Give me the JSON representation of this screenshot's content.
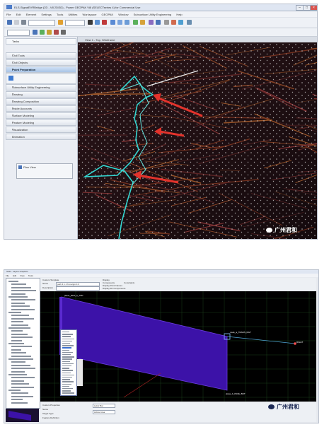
{
  "top_window": {
    "title": "ELS-SignalEVRBridge (2D - V8 2D/3D) - Power GEOPAK V8i (SELECTseries 4) for Commercial Use",
    "menu": [
      "File",
      "Edit",
      "Element",
      "Settings",
      "Tools",
      "Utilities",
      "Workspace",
      "GEOPAK",
      "Window",
      "Subsurface Utility Engineering",
      "Help"
    ],
    "sidebar": {
      "task_title": "Tasks",
      "sections": [
        {
          "label": "Civil Tools",
          "kind": "item"
        },
        {
          "label": "Civil Objects",
          "kind": "item"
        },
        {
          "label": "Point Preparation",
          "kind": "header"
        },
        {
          "label": "Subsurface Utility Engineering",
          "kind": "item"
        },
        {
          "label": "Drawing",
          "kind": "item"
        },
        {
          "label": "Drawing Composition",
          "kind": "item"
        },
        {
          "label": "Inside Accounts",
          "kind": "item"
        },
        {
          "label": "Surface Modeling",
          "kind": "item"
        },
        {
          "label": "Feature Modeling",
          "kind": "item"
        },
        {
          "label": "Visualization",
          "kind": "item"
        },
        {
          "label": "Animation",
          "kind": "item"
        }
      ],
      "flyout_label": "Plan View"
    },
    "view_title": "View 1 - Top, Wireframe",
    "watermark": "广州君和"
  },
  "bottom_window": {
    "title": "SUE - Layers Graphics",
    "menu": [
      "File",
      "Edit",
      "View",
      "Tools"
    ],
    "properties": {
      "template_label": "Custom Template",
      "name_label": "Name",
      "name_value": "path 3 1 2 6 margin 0.0",
      "description_label": "Description",
      "display_label": "Display",
      "option_1": "Components",
      "option_2": "Constraints",
      "option_3": "Display Point Names",
      "option_4": "Display 3D Components"
    },
    "bottom_panel": {
      "label_1": "Custom Properties",
      "label_2": "Name",
      "label_3": "Target Type",
      "label_4": "Feature Definition",
      "value_1": "Label Bar",
      "value_2": "Active Area"
    },
    "canvas_labels": {
      "top_left": "plane_label_a_TOP",
      "right_node": "node_a_TRANS_RGT",
      "far_right": "RIGHT",
      "bottom": "plane_b_PAVE_BOT"
    },
    "watermark": "广州君和"
  }
}
